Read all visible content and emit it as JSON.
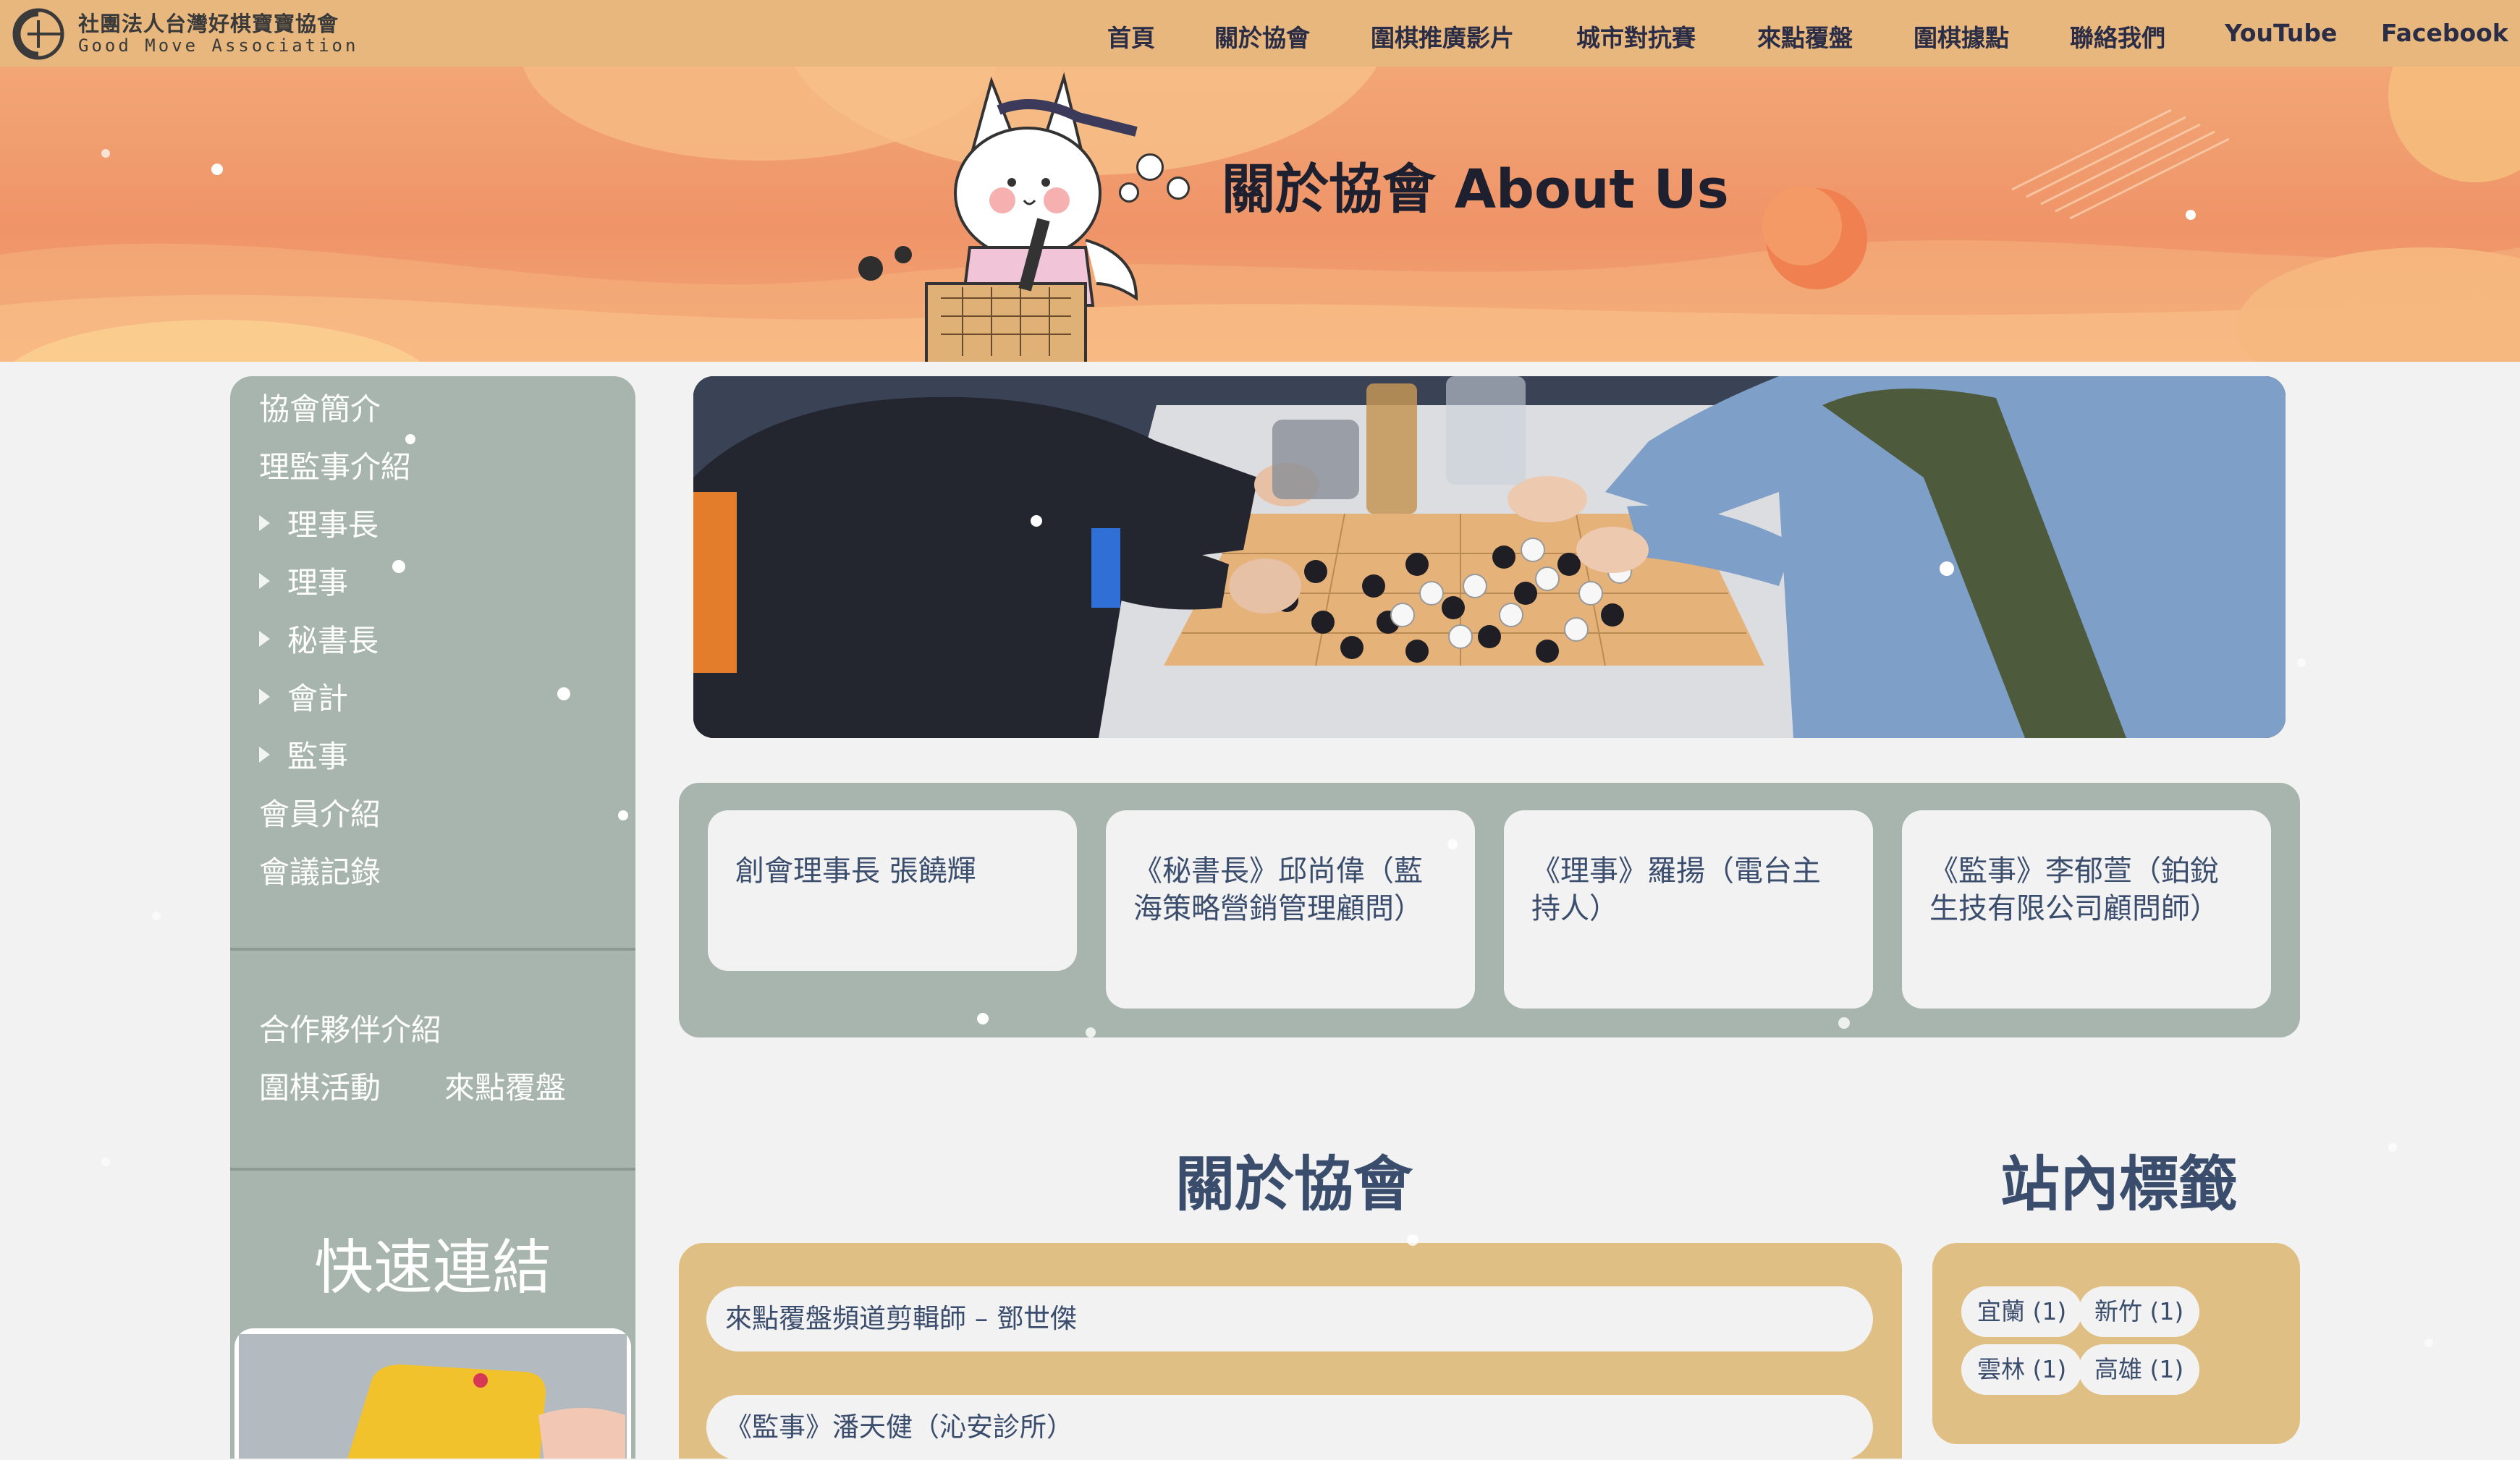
{
  "brand": {
    "name_cn": "社團法人台灣好棋寶寶協會",
    "name_en": "Good Move Association"
  },
  "nav": {
    "items": [
      {
        "label": "首頁"
      },
      {
        "label": "關於協會"
      },
      {
        "label": "圍棋推廣影片"
      },
      {
        "label": "城市對抗賽"
      },
      {
        "label": "來點覆盤"
      },
      {
        "label": "圍棋據點"
      },
      {
        "label": "聯絡我們"
      },
      {
        "label": "YouTube"
      },
      {
        "label": "Facebook"
      }
    ]
  },
  "hero": {
    "title": "關於協會 About Us"
  },
  "sidebar": {
    "menu": [
      {
        "label": "協會簡介"
      },
      {
        "label": "理監事介紹"
      },
      {
        "label": "理事長"
      },
      {
        "label": "理事"
      },
      {
        "label": "秘書長"
      },
      {
        "label": "會計"
      },
      {
        "label": "監事"
      },
      {
        "label": "會員介紹"
      },
      {
        "label": "會議記錄"
      }
    ],
    "secondary": {
      "partners": "合作夥伴介紹",
      "activities": "圍棋活動",
      "review": "來點覆盤"
    },
    "quick_links_title": "快速連結"
  },
  "board_cards": [
    {
      "text": "創會理事長 張饒輝"
    },
    {
      "text": "《秘書長》邱尚偉（藍海策略營銷管理顧問）"
    },
    {
      "text": "《理事》羅揚（電台主持人）"
    },
    {
      "text": "《監事》李郁萱（鉑銳生技有限公司顧問師）"
    }
  ],
  "about": {
    "title": "關於協會",
    "items": [
      {
        "text": "來點覆盤頻道剪輯師 – 鄧世傑"
      },
      {
        "text": "《監事》潘天健（沁安診所）"
      }
    ]
  },
  "tags": {
    "title": "站內標籤",
    "items": [
      {
        "label": "宜蘭 (1)"
      },
      {
        "label": "新竹 (1)"
      },
      {
        "label": "雲林 (1)"
      },
      {
        "label": "高雄 (1)"
      }
    ]
  },
  "colors": {
    "nav_bg": "#e7b77e",
    "hero_bg": "#ef9468",
    "sidebar_bg": "#a7b5ae",
    "accent_box": "#e0bf85",
    "heading_text": "#3b4d6d"
  }
}
